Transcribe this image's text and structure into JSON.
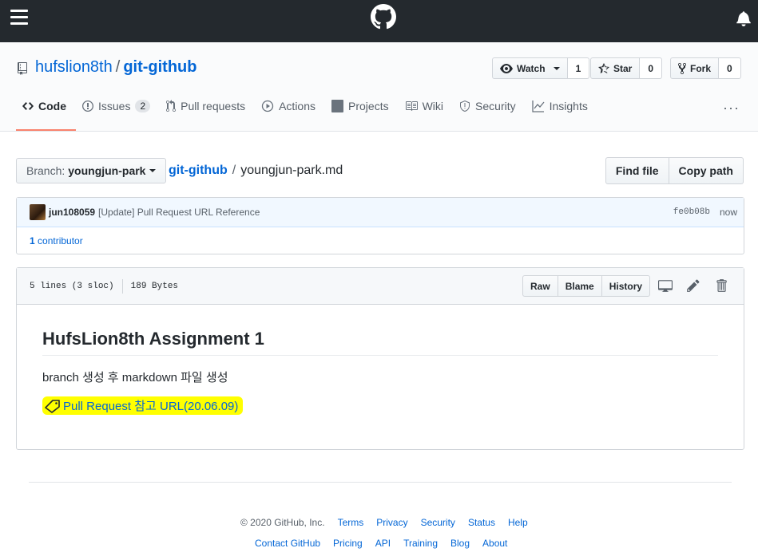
{
  "topbar": {
    "menu_icon": "hamburger-icon",
    "logo_icon": "github-logo-icon",
    "bell_icon": "bell-icon"
  },
  "repo": {
    "owner": "hufslion8th",
    "separator": "/",
    "name": "git-github",
    "watch_label": "Watch",
    "watch_count": "1",
    "star_label": "Star",
    "star_count": "0",
    "fork_label": "Fork",
    "fork_count": "0"
  },
  "tabs": [
    {
      "label": "Code",
      "icon": "code-icon"
    },
    {
      "label": "Issues",
      "icon": "issue-icon",
      "count": "2"
    },
    {
      "label": "Pull requests",
      "icon": "pull-request-icon"
    },
    {
      "label": "Actions",
      "icon": "play-icon"
    },
    {
      "label": "Projects",
      "icon": "project-icon"
    },
    {
      "label": "Wiki",
      "icon": "book-icon"
    },
    {
      "label": "Security",
      "icon": "shield-icon"
    },
    {
      "label": "Insights",
      "icon": "graph-icon"
    }
  ],
  "more_label": "···",
  "breadcrumb": {
    "branch_label": "Branch:",
    "branch_value": "youngjun-park",
    "root": "git-github",
    "separator": "/",
    "file": "youngjun-park.md",
    "find_file": "Find file",
    "copy_path": "Copy path"
  },
  "commit": {
    "author": "jun108059",
    "message": "[Update] Pull Request URL Reference",
    "sha": "fe0b08b",
    "when": "now",
    "contributors_count": "1",
    "contributors_label": "contributor"
  },
  "file": {
    "lines": "5 lines (3 sloc)",
    "size": "189 Bytes",
    "raw": "Raw",
    "blame": "Blame",
    "history": "History",
    "heading": "HufsLion8th Assignment 1",
    "paragraph": "branch 생성 후 markdown 파일 생성",
    "link_text": "Pull Request 참고 URL(20.06.09)"
  },
  "footer": {
    "copyright": "© 2020 GitHub, Inc.",
    "row1": [
      "Terms",
      "Privacy",
      "Security",
      "Status",
      "Help"
    ],
    "row2": [
      "Contact GitHub",
      "Pricing",
      "API",
      "Training",
      "Blog",
      "About"
    ]
  }
}
